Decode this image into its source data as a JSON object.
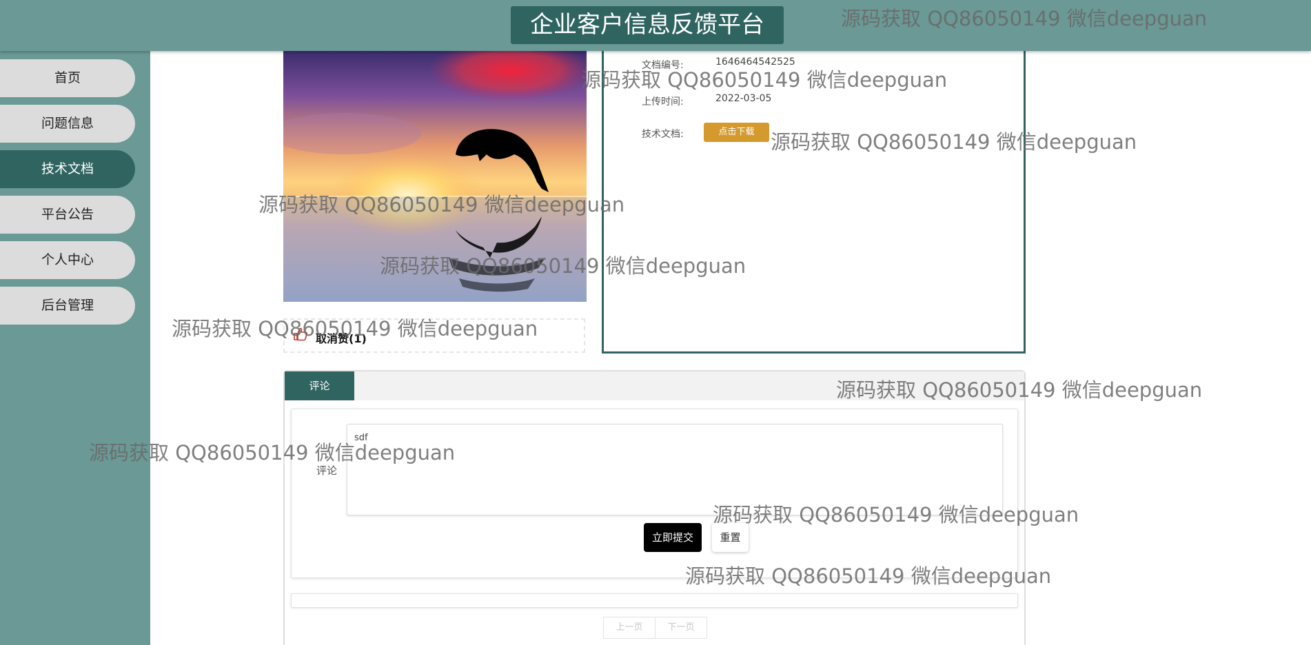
{
  "header": {
    "title": "企业客户信息反馈平台"
  },
  "sidebar": {
    "items": [
      {
        "label": "首页"
      },
      {
        "label": "问题信息"
      },
      {
        "label": "技术文档"
      },
      {
        "label": "平台公告"
      },
      {
        "label": "个人中心"
      },
      {
        "label": "后台管理"
      }
    ],
    "active": "技术文档"
  },
  "like": {
    "label": "取消赞(1)"
  },
  "document": {
    "number_label": "文档编号:",
    "number_value": "1646464542525",
    "upload_label": "上传时间:",
    "upload_value": "2022-03-05",
    "file_label": "技术文档:",
    "download_label": "点击下载"
  },
  "comments": {
    "tab_label": "评论",
    "field_label": "评论",
    "textarea_value": "sdf",
    "submit_label": "立即提交",
    "reset_label": "重置"
  },
  "pagination": {
    "prev_label": "上一页",
    "next_label": "下一页"
  },
  "watermark": {
    "text": "源码获取 QQ86050149 微信deepguan"
  },
  "colors": {
    "header_bg": "#6a9996",
    "accent_dark": "#2f6461",
    "nav_inactive_bg": "#dcdcdc",
    "download_button": "#d49a2e",
    "submit_button": "#000000"
  }
}
